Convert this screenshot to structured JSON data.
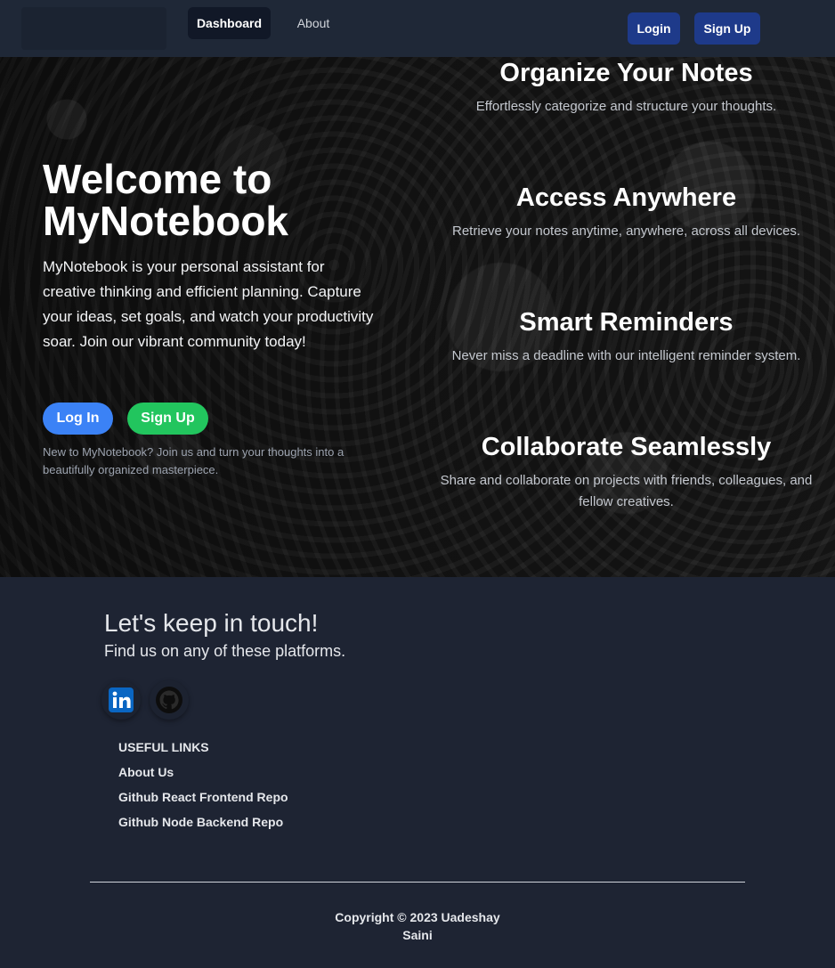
{
  "nav": {
    "dashboard_label": "Dashboard",
    "about_label": "About",
    "login_label": "Login",
    "signup_label": "Sign Up"
  },
  "hero": {
    "title": "Welcome to MyNotebook",
    "description": "MyNotebook is your personal assistant for creative thinking and efficient planning. Capture your ideas, set goals, and watch your productivity soar. Join our vibrant community today!",
    "login_label": "Log In",
    "signup_label": "Sign Up",
    "note": "New to MyNotebook? Join us and turn your thoughts into a beautifully organized masterpiece."
  },
  "features": [
    {
      "title": "Organize Your Notes",
      "text": "Effortlessly categorize and structure your thoughts."
    },
    {
      "title": "Access Anywhere",
      "text": "Retrieve your notes anytime, anywhere, across all devices."
    },
    {
      "title": "Smart Reminders",
      "text": "Never miss a deadline with our intelligent reminder system."
    },
    {
      "title": "Collaborate Seamlessly",
      "text": "Share and collaborate on projects with friends, colleagues, and fellow creatives."
    }
  ],
  "footer": {
    "title": "Let's keep in touch!",
    "subtitle": "Find us on any of these platforms.",
    "social": [
      {
        "icon": "linkedin-icon",
        "color": "#0a66c2"
      },
      {
        "icon": "github-icon",
        "color": "#000000"
      }
    ],
    "links_title": "USEFUL LINKS",
    "links": [
      "About Us",
      "Github React Frontend Repo",
      "Github Node Backend Repo"
    ],
    "copyright": "Copyright © 2023 Uadeshay Saini"
  },
  "colors": {
    "navbar_bg": "#1f2837",
    "page_bg": "#1e2433",
    "nav_button": "#1e3a8a",
    "login_button": "#3b82f6",
    "signup_button": "#22c55e"
  }
}
